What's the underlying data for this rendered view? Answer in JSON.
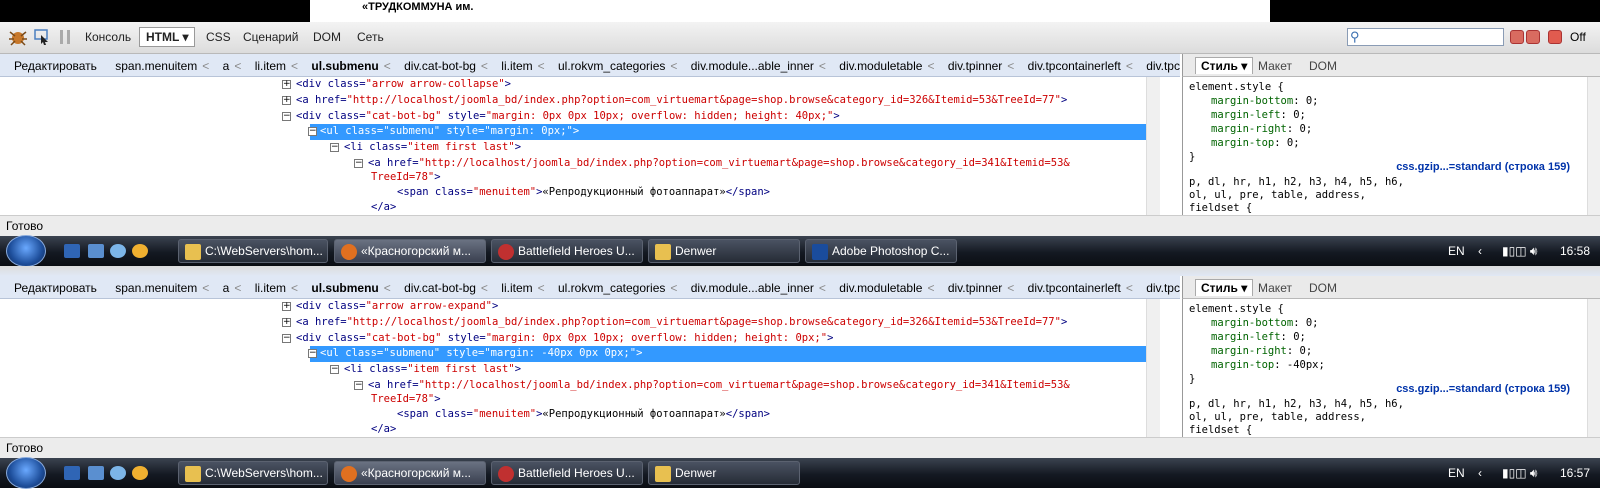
{
  "page": {
    "partial_title": "«ТРУДКОММУНА им."
  },
  "toolbar": {
    "items": [
      "Консоль",
      "HTML",
      "CSS",
      "Сценарий",
      "DOM",
      "Сеть"
    ],
    "off_label": "Off"
  },
  "breadcrumb": [
    "Редактировать",
    "span.menuitem",
    "a",
    "li.item",
    "ul.submenu",
    "div.cat-bot-bg",
    "li.item",
    "ul.rokvm_categories",
    "div.module...able_inner",
    "div.moduletable",
    "div.tpinner",
    "div.tpcontainerleft",
    "div.tpcont..."
  ],
  "side_tabs": [
    "Стиль",
    "Макет",
    "DOM"
  ],
  "status_text": "Готово",
  "panels": [
    {
      "code": {
        "l1": {
          "tag": "<div",
          "attr": " class=",
          "val": "\"arrow arrow-collapse\"",
          "end": ">"
        },
        "l2": {
          "tag": "<a",
          "attr": " href=",
          "val": "\"http://localhost/joomla_bd/index.php?option=com_virtuemart&page=shop.browse&category_id=326&Itemid=53&TreeId=77\"",
          "end": ">"
        },
        "l3": {
          "tag": "<div",
          "attr": " class=",
          "val": "\"cat-bot-bg\"",
          "attr2": " style=",
          "val2": "\"margin: 0px 0px 10px; overflow: hidden; height: 40px;\"",
          "end": ">"
        },
        "l4": "<ul class=\"submenu\" style=\"margin: 0px;\">",
        "l5": {
          "tag": "<li",
          "attr": " class=",
          "val": "\"item first last\"",
          "end": ">"
        },
        "l6": {
          "tag": "<a",
          "attr": " href=",
          "val": "\"http://localhost/joomla_bd/index.php?option=com_virtuemart&page=shop.browse&category_id=341&Itemid=53&",
          "val_cont": "TreeId=78\"",
          "end": ">"
        },
        "l7": {
          "tag": "<span",
          "attr": " class=",
          "val": "\"menuitem\"",
          "text": "«Репродукционный фотоаппарат»",
          "close": "</span>"
        },
        "l8": "</a>"
      },
      "css": {
        "selector": "element.style {",
        "props": [
          [
            "margin-bottom",
            "0;"
          ],
          [
            "margin-left",
            "0;"
          ],
          [
            "margin-right",
            "0;"
          ],
          [
            "margin-top",
            "0;"
          ]
        ],
        "close": "}",
        "source": "css.gzip...=standard (строка 159)",
        "sel2a": "p, dl, hr, h1, h2, h3, h4, h5, h6,",
        "sel2b": "ol, ul, pre, table, address,",
        "sel2c": "fieldset {"
      },
      "taskbar": {
        "buttons": [
          "C:\\WebServers\\hom...",
          "«Красногорский м...",
          "Battlefield Heroes U...",
          "Denwer",
          "Adobe Photoshop C..."
        ],
        "lang": "EN",
        "time": "16:58"
      }
    },
    {
      "code": {
        "l1": {
          "tag": "<div",
          "attr": " class=",
          "val": "\"arrow arrow-expand\"",
          "end": ">"
        },
        "l2": {
          "tag": "<a",
          "attr": " href=",
          "val": "\"http://localhost/joomla_bd/index.php?option=com_virtuemart&page=shop.browse&category_id=326&Itemid=53&TreeId=77\"",
          "end": ">"
        },
        "l3": {
          "tag": "<div",
          "attr": " class=",
          "val": "\"cat-bot-bg\"",
          "attr2": " style=",
          "val2": "\"margin: 0px 0px 10px; overflow: hidden; height: 0px;\"",
          "end": ">"
        },
        "l4": "<ul class=\"submenu\" style=\"margin: -40px 0px 0px;\">",
        "l5": {
          "tag": "<li",
          "attr": " class=",
          "val": "\"item first last\"",
          "end": ">"
        },
        "l6": {
          "tag": "<a",
          "attr": " href=",
          "val": "\"http://localhost/joomla_bd/index.php?option=com_virtuemart&page=shop.browse&category_id=341&Itemid=53&",
          "val_cont": "TreeId=78\"",
          "end": ">"
        },
        "l7": {
          "tag": "<span",
          "attr": " class=",
          "val": "\"menuitem\"",
          "text": "«Репродукционный фотоаппарат»",
          "close": "</span>"
        },
        "l8": "</a>"
      },
      "css": {
        "selector": "element.style {",
        "props": [
          [
            "margin-bottom",
            "0;"
          ],
          [
            "margin-left",
            "0;"
          ],
          [
            "margin-right",
            "0;"
          ],
          [
            "margin-top",
            "-40px;"
          ]
        ],
        "close": "}",
        "source": "css.gzip...=standard (строка 159)",
        "sel2a": "p, dl, hr, h1, h2, h3, h4, h5, h6,",
        "sel2b": "ol, ul, pre, table, address,",
        "sel2c": "fieldset {"
      },
      "taskbar": {
        "buttons": [
          "C:\\WebServers\\hom...",
          "«Красногорский м...",
          "Battlefield Heroes U...",
          "Denwer"
        ],
        "lang": "EN",
        "time": "16:57"
      }
    }
  ]
}
